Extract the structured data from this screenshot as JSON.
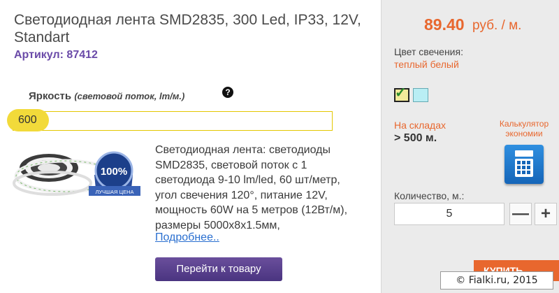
{
  "product": {
    "title": "Светодиодная лента SMD2835, 300 Led, IP33, 12V, Standart",
    "sku_label": "Артикул: 87412",
    "brightness_label": "Яркость",
    "brightness_unit": "(световой поток, lm/м.)",
    "help_icon_glyph": "?",
    "brightness_value": "600",
    "badge_line1": "100%",
    "badge_line2": "ЛУЧШАЯ ЦЕНА",
    "description": "Светодиодная лента: светодиоды SMD2835, световой поток с 1 светодиода 9-10 lm/led, 60 шт/метр, угол свечения 120°, питание 12V, мощность 60W на 5 метров (12Вт/м), размеры 5000x8x1.5мм,",
    "more_link": "Подробнее..",
    "goto_button": "Перейти к товару"
  },
  "sidebar": {
    "price": "89.40",
    "price_unit": "руб. / м.",
    "color_label": "Цвет свечения:",
    "color_value": "теплый белый",
    "color_swatches": [
      {
        "name": "warm-white",
        "color": "#f3ea9a",
        "selected": true
      },
      {
        "name": "cool-white",
        "color": "#b9eef4",
        "selected": false
      }
    ],
    "stock_label": "На складах",
    "stock_value": "> 500 м.",
    "calculator_label": "Калькулятор экономии",
    "quantity_label": "Количество, м.:",
    "quantity_value": "5",
    "minus_label": "—",
    "plus_label": "+",
    "buy_button": "КУПИТЬ"
  },
  "watermark": "© Fialki.ru, 2015",
  "colors": {
    "accent_orange": "#e8672e",
    "accent_purple": "#5a3f8e",
    "highlight_yellow": "#f2da3a",
    "link_blue": "#2a6fd0"
  }
}
